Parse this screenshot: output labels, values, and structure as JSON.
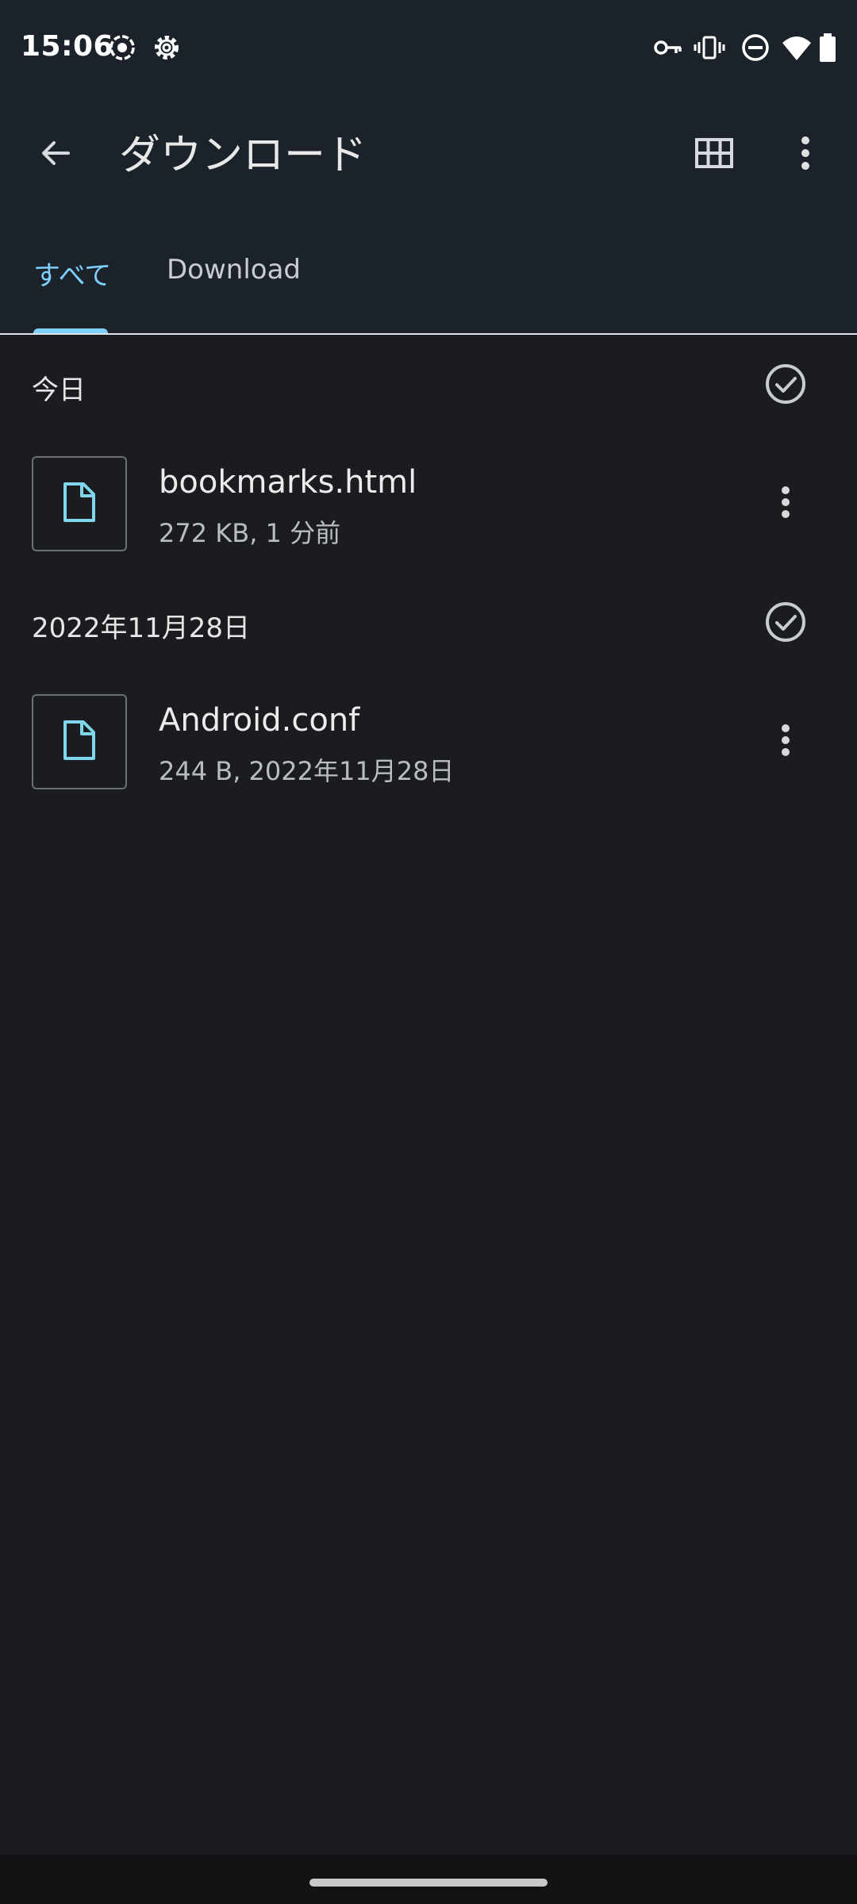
{
  "status_bar": {
    "time": "15:06",
    "left_icons": [
      "screen-record-icon",
      "settings-icon"
    ],
    "right_icons": [
      "vpn-key-icon",
      "vibrate-icon",
      "do-not-disturb-icon",
      "wifi-icon",
      "battery-icon"
    ]
  },
  "app_bar": {
    "title": "ダウンロード",
    "back_icon": "arrow-back-icon",
    "grid_icon": "grid-view-icon",
    "overflow_icon": "more-vert-icon"
  },
  "tabs": [
    {
      "label": "すべて",
      "selected": true
    },
    {
      "label": "Download",
      "selected": false
    }
  ],
  "sections": [
    {
      "title": "今日",
      "files": [
        {
          "name": "bookmarks.html",
          "meta": "272 KB, 1 分前",
          "icon": "file-icon"
        }
      ]
    },
    {
      "title": "2022年11月28日",
      "files": [
        {
          "name": "Android.conf",
          "meta": "244 B, 2022年11月28日",
          "icon": "file-icon"
        }
      ]
    }
  ],
  "colors": {
    "accent": "#7fcfff",
    "header_bg": "#1b222a",
    "content_bg": "#1a1c1f",
    "file_icon": "#7fd6ea"
  }
}
